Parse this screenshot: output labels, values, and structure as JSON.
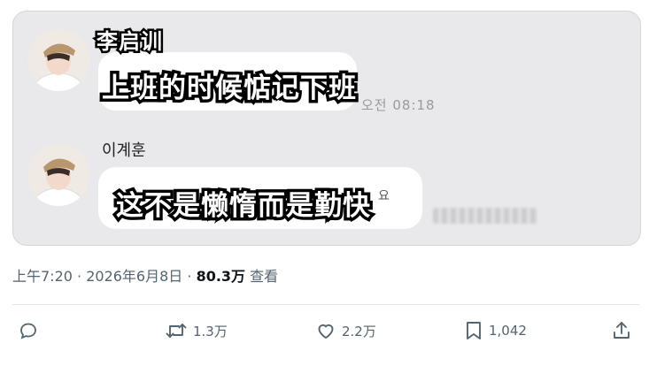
{
  "chat": {
    "overlay_name": "李启训",
    "message1_overlay": "上班的时候惦记下班",
    "message1_time": "오전 08:18",
    "sender_name": "이계훈",
    "message2_overlay": "这不是懒惰而是勤快",
    "message2_tail": "요"
  },
  "post": {
    "time": "上午7:20",
    "date": "2026年6月8日",
    "views_count": "80.3万",
    "views_label": "查看"
  },
  "actions": {
    "reply_icon": "reply-icon",
    "retweet_icon": "retweet-icon",
    "retweet_count": "1.3万",
    "like_icon": "heart-icon",
    "like_count": "2.2万",
    "bookmark_icon": "bookmark-icon",
    "bookmark_count": "1,042",
    "share_icon": "share-icon"
  },
  "colors": {
    "muted": "#536471",
    "card_bg": "#e9e9eb"
  }
}
